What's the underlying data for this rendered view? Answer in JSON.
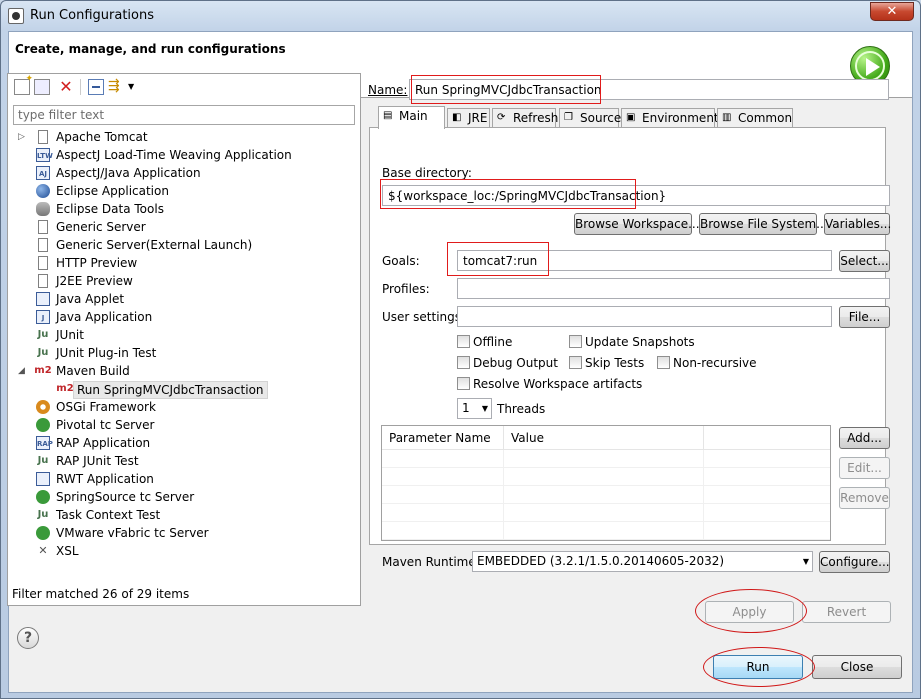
{
  "window": {
    "title": "Run Configurations",
    "close_glyph": "✕"
  },
  "header": {
    "title": "Create, manage, and run configurations"
  },
  "left": {
    "filter_placeholder": "type filter text",
    "items": [
      {
        "label": "Apache Tomcat",
        "icon": "tomcat-icon",
        "has_arrow": true
      },
      {
        "label": "AspectJ Load-Time Weaving Application",
        "icon": "ltw-icon",
        "badge": "LTW"
      },
      {
        "label": "AspectJ/Java Application",
        "icon": "aj-icon",
        "badge": "AJ"
      },
      {
        "label": "Eclipse Application",
        "icon": "eclipse-icon"
      },
      {
        "label": "Eclipse Data Tools",
        "icon": "database-icon"
      },
      {
        "label": "Generic Server",
        "icon": "server-icon"
      },
      {
        "label": "Generic Server(External Launch)",
        "icon": "server-icon"
      },
      {
        "label": "HTTP Preview",
        "icon": "server-icon"
      },
      {
        "label": "J2EE Preview",
        "icon": "server-icon"
      },
      {
        "label": "Java Applet",
        "icon": "applet-icon"
      },
      {
        "label": "Java Application",
        "icon": "java-app-icon",
        "badge": "J"
      },
      {
        "label": "JUnit",
        "icon": "junit-icon",
        "badge": "Ju"
      },
      {
        "label": "JUnit Plug-in Test",
        "icon": "junit-plugin-icon",
        "badge": "Ju"
      },
      {
        "label": "Maven Build",
        "icon": "maven-icon",
        "badge": "m2",
        "expanded": true
      },
      {
        "label": "Run SpringMVCJdbcTransaction",
        "icon": "maven-icon",
        "badge": "m2",
        "child": true,
        "selected": true
      },
      {
        "label": "OSGi Framework",
        "icon": "osgi-icon"
      },
      {
        "label": "Pivotal tc Server",
        "icon": "pivotal-icon"
      },
      {
        "label": "RAP Application",
        "icon": "rap-icon",
        "badge": "RAP"
      },
      {
        "label": "RAP JUnit Test",
        "icon": "rap-junit-icon",
        "badge": "Ju"
      },
      {
        "label": "RWT Application",
        "icon": "rwt-icon"
      },
      {
        "label": "SpringSource tc Server",
        "icon": "springsource-icon"
      },
      {
        "label": "Task Context Test",
        "icon": "task-context-icon",
        "badge": "Ju"
      },
      {
        "label": "VMware vFabric tc Server",
        "icon": "vfabric-icon"
      },
      {
        "label": "XSL",
        "icon": "xsl-icon",
        "badge": "✕"
      }
    ],
    "status": "Filter matched 26 of 29 items"
  },
  "main": {
    "name_label": "Name:",
    "name_value": "Run SpringMVCJdbcTransaction",
    "tabs": [
      {
        "label": "Main",
        "icon": "main-tab-icon",
        "glyph": "▤"
      },
      {
        "label": "JRE",
        "icon": "jre-icon",
        "glyph": "◧"
      },
      {
        "label": "Refresh",
        "icon": "refresh-icon",
        "glyph": "⟳"
      },
      {
        "label": "Source",
        "icon": "source-icon",
        "glyph": "❐"
      },
      {
        "label": "Environment",
        "icon": "environment-icon",
        "glyph": "▣"
      },
      {
        "label": "Common",
        "icon": "common-icon",
        "glyph": "▥"
      }
    ],
    "base_dir_label": "Base directory:",
    "base_dir_value": "${workspace_loc:/SpringMVCJdbcTransaction}",
    "browse_workspace": "Browse Workspace...",
    "browse_filesystem": "Browse File System...",
    "variables": "Variables...",
    "goals_label": "Goals:",
    "goals_value": "tomcat7:run",
    "select_button": "Select...",
    "profiles_label": "Profiles:",
    "profiles_value": "",
    "user_settings_label": "User settings:",
    "user_settings_value": "",
    "file_button": "File...",
    "checks": {
      "offline": "Offline",
      "update_snapshots": "Update Snapshots",
      "debug_output": "Debug Output",
      "skip_tests": "Skip Tests",
      "non_recursive": "Non-recursive",
      "resolve_workspace": "Resolve Workspace artifacts"
    },
    "threads_value": "1",
    "threads_label": "Threads",
    "table": {
      "col1": "Parameter Name",
      "col2": "Value"
    },
    "add_button": "Add...",
    "edit_button": "Edit...",
    "remove_button": "Remove",
    "runtime_label": "Maven Runtime:",
    "runtime_value": "EMBEDDED (3.2.1/1.5.0.20140605-2032)",
    "configure_button": "Configure...",
    "apply_button": "Apply",
    "revert_button": "Revert"
  },
  "footer": {
    "help": "?",
    "run_button": "Run",
    "close_button": "Close"
  },
  "colors": {
    "annotation": "#e01b1b",
    "accent": "#3c7fb1"
  }
}
